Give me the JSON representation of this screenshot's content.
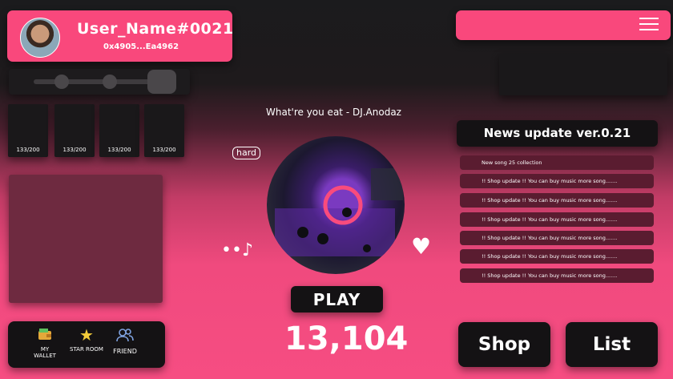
{
  "profile": {
    "username": "User_Name#0021",
    "address": "0x4905...Ea4962"
  },
  "counters": [
    "133/200",
    "133/200",
    "133/200",
    "133/200"
  ],
  "nav": {
    "wallet": "MY WALLET",
    "star_room": "STAR ROOM",
    "friend": "FRIEND"
  },
  "song": {
    "title": "What're you eat -  DJ.Anodaz",
    "difficulty": "hard"
  },
  "play_label": "PLAY",
  "score": "13,104",
  "news": {
    "title": "News update ver.0.21",
    "items": [
      "New song 25 collection",
      "!! Shop update !! You can buy music more song.......",
      "!! Shop update !! You can buy music more song.......",
      "!! Shop update !! You can buy music more song.......",
      "!! Shop update !! You can buy music more song.......",
      "!! Shop update !! You can buy music more song.......",
      "!! Shop update !! You can buy music more song......."
    ]
  },
  "shop_label": "Shop",
  "list_label": "List",
  "colors": {
    "accent": "#f9487c",
    "panel": "#141214"
  }
}
